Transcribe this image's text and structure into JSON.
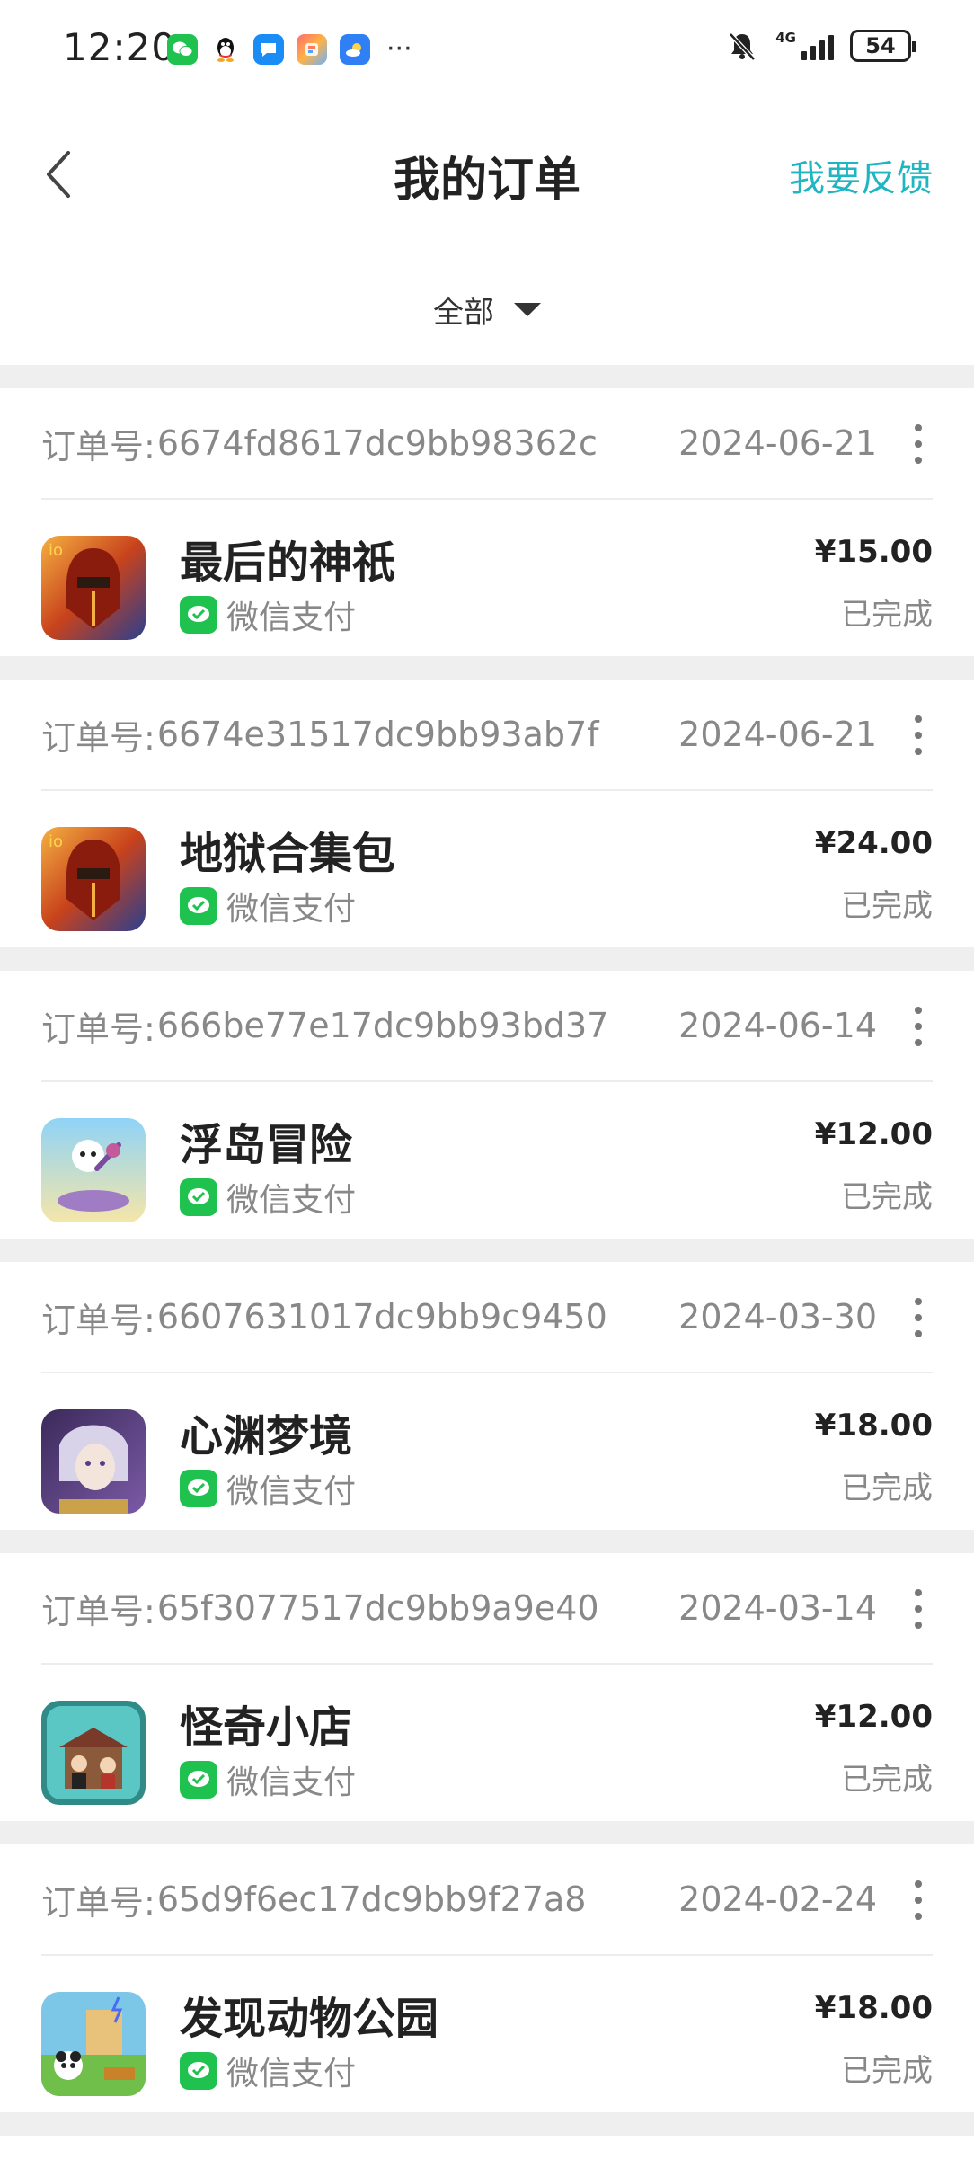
{
  "status_bar": {
    "time": "12:20",
    "network": "4G",
    "battery": "54",
    "more": "···",
    "notification_icons": [
      "wechat-icon",
      "qq-icon",
      "message-icon",
      "tool-app-icon",
      "weather-icon"
    ]
  },
  "header": {
    "title": "我的订单",
    "feedback": "我要反馈"
  },
  "filter": {
    "label": "全部"
  },
  "orders": [
    {
      "no_label": "订单号:",
      "order_no": "6674fd8617dc9bb98362c",
      "date": "2024-06-21",
      "game": "最后的神祇",
      "payment": "微信支付",
      "price": "¥15.00",
      "status": "已完成",
      "icon": "last-god-game-icon"
    },
    {
      "no_label": "订单号:",
      "order_no": "6674e31517dc9bb93ab7f",
      "date": "2024-06-21",
      "game": "地狱合集包",
      "payment": "微信支付",
      "price": "¥24.00",
      "status": "已完成",
      "icon": "last-god-game-icon"
    },
    {
      "no_label": "订单号:",
      "order_no": "666be77e17dc9bb93bd37",
      "date": "2024-06-14",
      "game": "浮岛冒险",
      "payment": "微信支付",
      "price": "¥12.00",
      "status": "已完成",
      "icon": "floating-island-game-icon"
    },
    {
      "no_label": "订单号:",
      "order_no": "6607631017dc9bb9c9450",
      "date": "2024-03-30",
      "game": "心渊梦境",
      "payment": "微信支付",
      "price": "¥18.00",
      "status": "已完成",
      "icon": "dreamscape-game-icon"
    },
    {
      "no_label": "订单号:",
      "order_no": "65f3077517dc9bb9a9e40",
      "date": "2024-03-14",
      "game": "怪奇小店",
      "payment": "微信支付",
      "price": "¥12.00",
      "status": "已完成",
      "icon": "odd-shop-game-icon"
    },
    {
      "no_label": "订单号:",
      "order_no": "65d9f6ec17dc9bb9f27a8",
      "date": "2024-02-24",
      "game": "发现动物公园",
      "payment": "微信支付",
      "price": "¥18.00",
      "status": "已完成",
      "icon": "animal-park-game-icon"
    }
  ],
  "colors": {
    "accent": "#1fb5c2",
    "wechat_green": "#1fc24e",
    "divider": "#efefef"
  }
}
